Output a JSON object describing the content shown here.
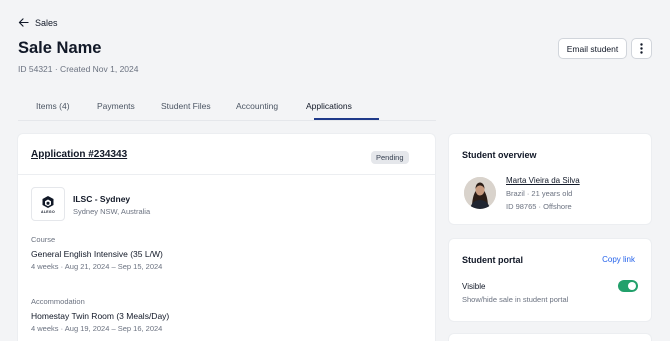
{
  "header": {
    "back_label": "Sales",
    "title": "Sale Name",
    "meta": "ID 54321 · Created Nov 1, 2024",
    "email_button": "Email student"
  },
  "tabs": [
    {
      "label": "Items (4)",
      "active": false
    },
    {
      "label": "Payments",
      "active": false
    },
    {
      "label": "Student Files",
      "active": false
    },
    {
      "label": "Accounting",
      "active": false
    },
    {
      "label": "Applications",
      "active": true
    }
  ],
  "application": {
    "title": "Application #234343",
    "status": "Pending",
    "school": {
      "name": "ILSC - Sydney",
      "location": "Sydney NSW, Australia",
      "logo_text": "ALEGO"
    },
    "course": {
      "label": "Course",
      "name": "General English Intensive (35 L/W)",
      "details": "4 weeks · Aug 21, 2024 – Sep 15, 2024"
    },
    "accommodation": {
      "label": "Accommodation",
      "name": "Homestay Twin Room (3 Meals/Day)",
      "details": "4 weeks · Aug 19, 2024 – Sep 16, 2024"
    }
  },
  "student_overview": {
    "heading": "Student overview",
    "name": "Marta Vieira da Silva",
    "line1": "Brazil · 21 years old",
    "line2": "ID 98765 · Offshore"
  },
  "student_portal": {
    "heading": "Student portal",
    "copy_link": "Copy link",
    "visibility_label": "Visible",
    "visibility_desc": "Show/hide sale in student portal",
    "visible": true
  },
  "colors": {
    "accent": "#1f3a8a",
    "link": "#2563eb",
    "toggle_on": "#22a06b"
  }
}
